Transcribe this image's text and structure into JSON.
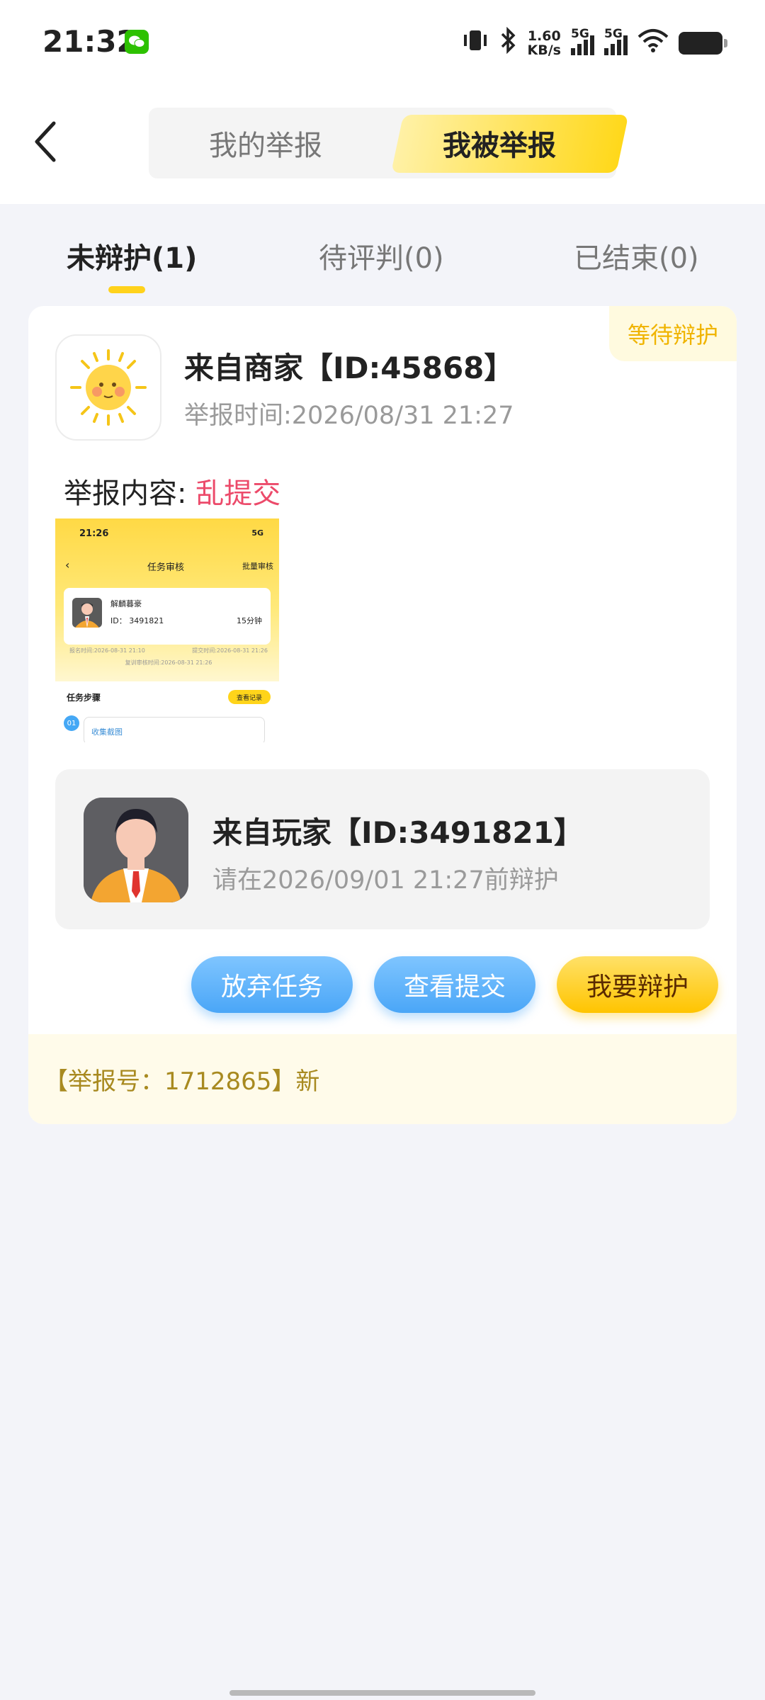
{
  "status_bar": {
    "time": "21:32",
    "speed_value": "1.60",
    "speed_unit": "KB/s",
    "sim1_label": "5G",
    "sim2_label": "5G"
  },
  "header": {
    "seg_left": "我的举报",
    "seg_right": "我被举报"
  },
  "subtabs": [
    {
      "label": "未辩护(1)"
    },
    {
      "label": "待评判(0)"
    },
    {
      "label": "已结束(0)"
    }
  ],
  "card": {
    "status_tag": "等待辩护",
    "merchant_title": "来自商家【ID:45868】",
    "report_time": "举报时间:2026/08/31 21:27",
    "content_label": "举报内容: ",
    "content_reason": "乱提交",
    "evidence": {
      "status_time": "21:26",
      "status_right": "5G",
      "nav_title": "任务审核",
      "nav_right": "批量审核",
      "name": "解麟暮豪",
      "id": "ID： 3491821",
      "mins": "15分钟",
      "date1": "报名时间:2026-08-31 21:10",
      "date2": "提交时间:2026-08-31 21:26",
      "date3": "复训审核时间:2026-08-31 21:26",
      "step_title": "任务步骤",
      "step_btn": "查看记录",
      "step_num": "01",
      "collect": "收集截图"
    },
    "player_title": "来自玩家【ID:3491821】",
    "player_deadline": "请在2026/09/01 21:27前辩护",
    "buttons": {
      "abandon": "放弃任务",
      "view": "查看提交",
      "defend": "我要辩护"
    },
    "report_no": "【举报号：1712865】新"
  },
  "colors": {
    "accent_yellow": "#ffd21c",
    "reason_red": "#ec4a6a",
    "button_blue": "#4aa6f7"
  }
}
